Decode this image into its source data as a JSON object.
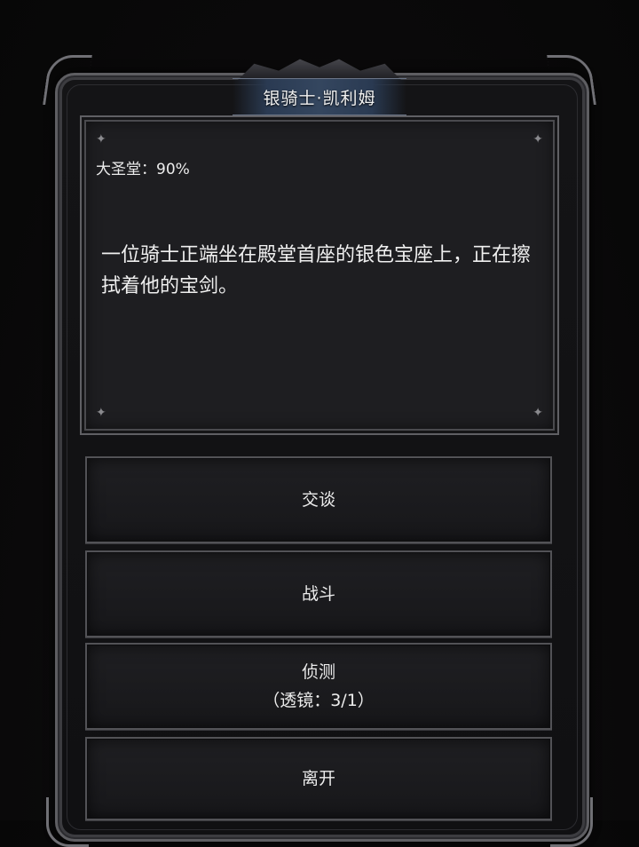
{
  "dialog": {
    "title": "银骑士·凯利姆",
    "location": "大圣堂：90%",
    "description": "一位骑士正端坐在殿堂首座的银色宝座上，正在擦拭着他的宝剑。"
  },
  "options": [
    {
      "label": "交谈"
    },
    {
      "label": "战斗"
    },
    {
      "label": "侦测",
      "sub": "（透镜：3/1）"
    },
    {
      "label": "离开"
    }
  ],
  "colors": {
    "background": "#0b0a0b",
    "panel": "#1e1e21",
    "border": "#606064",
    "title_bar": "#34465f",
    "text": "#f0f0f0"
  },
  "icons": [
    "sparkle-icon"
  ]
}
